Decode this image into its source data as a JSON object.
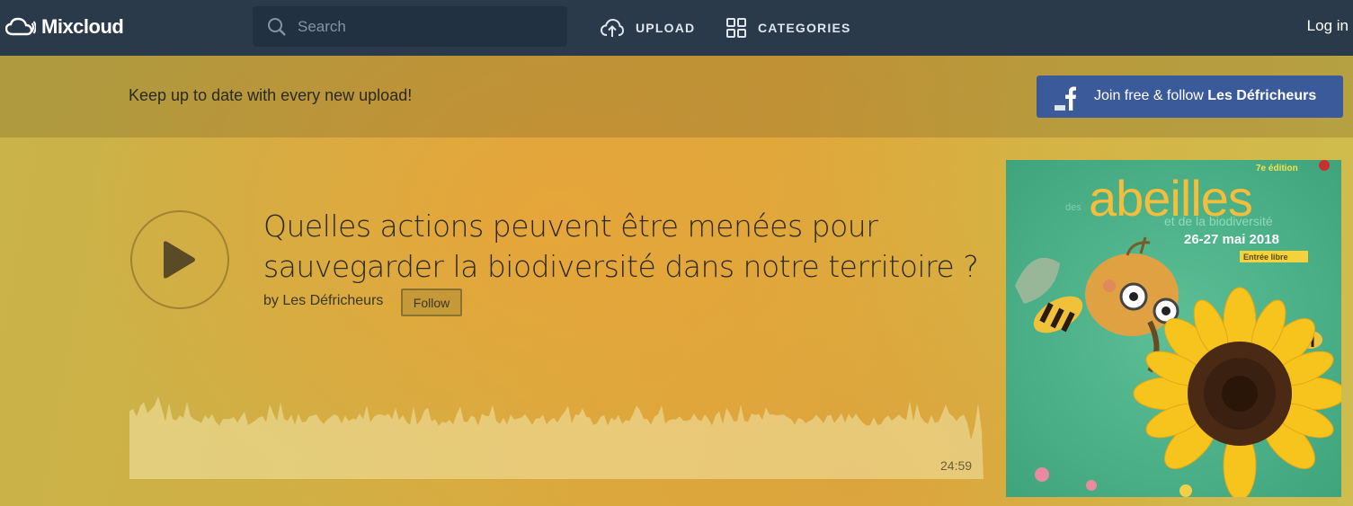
{
  "nav": {
    "logo": "Mixcloud",
    "search_placeholder": "Search",
    "upload": "UPLOAD",
    "categories": "CATEGORIES",
    "login": "Log in"
  },
  "banner": {
    "text": "Keep up to date with every new upload!",
    "fb_prefix": "Join free & follow ",
    "fb_name": "Les Défricheurs"
  },
  "show": {
    "title_line1": "Quelles actions peuvent être menées pour",
    "title_line2": "sauvegarder la biodiversité dans notre territoire ?",
    "by": "by Les Défricheurs",
    "follow": "Follow",
    "duration": "24:59"
  },
  "artwork": {
    "edition": "7e édition",
    "small_des": "des",
    "headline": "abeilles",
    "subtitle": "et de la biodiversité",
    "dates": "26-27 mai 2018",
    "place": "Entrée libre"
  },
  "colors": {
    "nav_bg": "#2b3a4a",
    "facebook": "#3b5a9a",
    "artwork_bg": "#4eb48c"
  }
}
